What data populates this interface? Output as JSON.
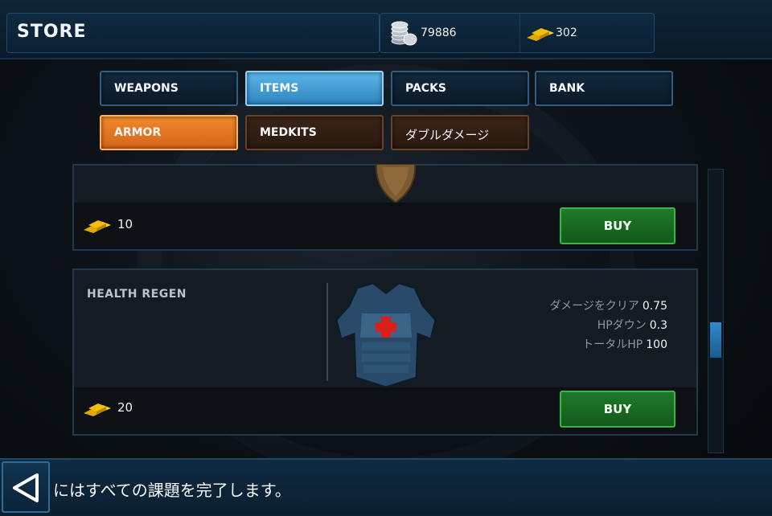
{
  "header": {
    "title": "STORE",
    "silver_amount": "79886",
    "gold_amount": "302"
  },
  "tabs": [
    {
      "label": "WEAPONS",
      "state": "normal"
    },
    {
      "label": "ITEMS",
      "state": "selected"
    },
    {
      "label": "PACKS",
      "state": "normal"
    },
    {
      "label": "BANK",
      "state": "normal"
    },
    {
      "label": "ARMOR",
      "state": "selected"
    },
    {
      "label": "MEDKITS",
      "state": "normal"
    },
    {
      "label": "ダブルダメージ",
      "state": "normal"
    }
  ],
  "items": [
    {
      "price": "10",
      "buy_label": "BUY"
    },
    {
      "name": "HEALTH REGEN",
      "stats": [
        {
          "label": "ダメージをクリア",
          "value": "0.75"
        },
        {
          "label": "HPダウン",
          "value": "0.3"
        },
        {
          "label": "トータルHP",
          "value": "100"
        }
      ],
      "price": "20",
      "buy_label": "BUY"
    }
  ],
  "scroll": {
    "position": 0.62
  },
  "footer": {
    "message": "にはすべての課題を完了します。"
  },
  "colors": {
    "selected_blue": "#3f9dd6",
    "selected_orange": "#e8772a",
    "buy_green": "#1f7a2a"
  }
}
